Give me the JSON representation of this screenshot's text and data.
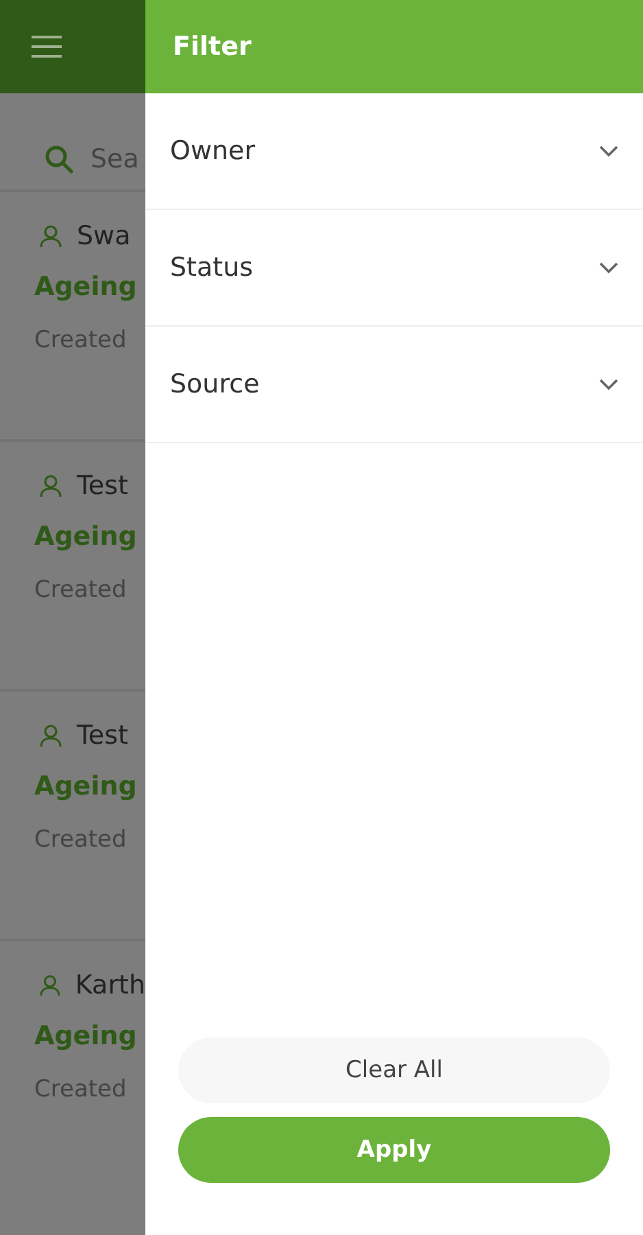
{
  "background": {
    "search": {
      "placeholder": "Sea"
    },
    "leads": [
      {
        "name": "Swa",
        "ageing": "Ageing",
        "created": "Created"
      },
      {
        "name": "Test",
        "ageing": "Ageing",
        "created": "Created"
      },
      {
        "name": "Test",
        "ageing": "Ageing",
        "created": "Created"
      },
      {
        "name": "Karth",
        "ageing": "Ageing",
        "created": "Created"
      }
    ]
  },
  "filter": {
    "title": "Filter",
    "sections": [
      {
        "label": "Owner",
        "expanded": false
      },
      {
        "label": "Status",
        "expanded": false
      },
      {
        "label": "Source",
        "expanded": false
      }
    ],
    "buttons": [
      {
        "kind": "secondary",
        "label": "Clear All"
      },
      {
        "kind": "primary",
        "label": "Apply"
      }
    ]
  }
}
